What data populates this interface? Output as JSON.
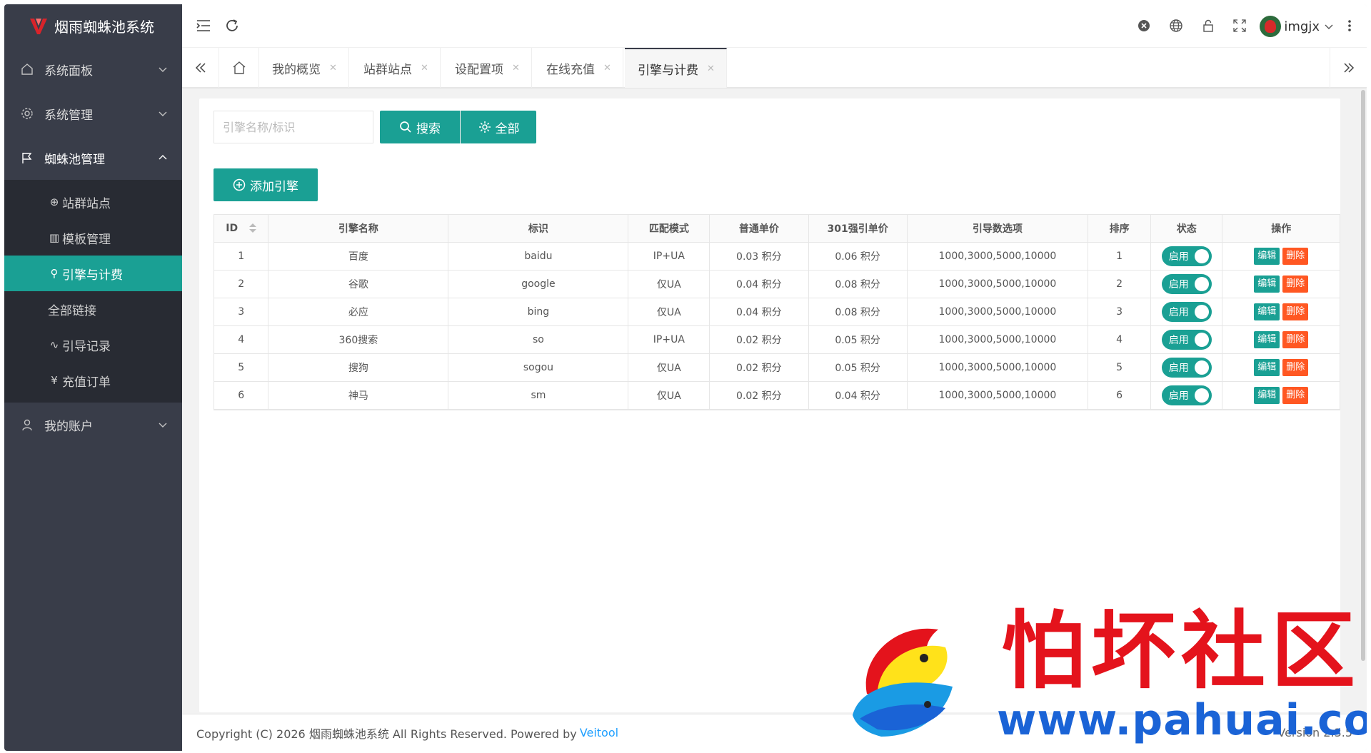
{
  "app": {
    "title": "烟雨蜘蛛池系统"
  },
  "sidebar": {
    "items": [
      {
        "label": "系统面板"
      },
      {
        "label": "系统管理"
      },
      {
        "label": "蜘蛛池管理"
      },
      {
        "label": "我的账户"
      }
    ],
    "sub_items": [
      {
        "label": "站群站点"
      },
      {
        "label": "模板管理"
      },
      {
        "label": "引擎与计费"
      },
      {
        "label": "全部链接"
      },
      {
        "label": "引导记录"
      },
      {
        "label": "充值订单"
      }
    ]
  },
  "header": {
    "username": "imgjx"
  },
  "tabs": [
    {
      "label": "我的概览"
    },
    {
      "label": "站群站点"
    },
    {
      "label": "设配置项"
    },
    {
      "label": "在线充值"
    },
    {
      "label": "引擎与计费"
    }
  ],
  "search": {
    "placeholder": "引擎名称/标识",
    "search_label": "搜索",
    "all_label": "全部"
  },
  "add_label": "添加引擎",
  "table": {
    "headers": [
      "ID",
      "引擎名称",
      "标识",
      "匹配模式",
      "普通单价",
      "301强引单价",
      "引导数选项",
      "排序",
      "状态",
      "操作"
    ],
    "status_label": "启用",
    "edit_label": "编辑",
    "delete_label": "删除",
    "rows": [
      [
        "1",
        "百度",
        "baidu",
        "IP+UA",
        "0.03 积分",
        "0.06 积分",
        "1000,3000,5000,10000",
        "1"
      ],
      [
        "2",
        "谷歌",
        "google",
        "仅UA",
        "0.04 积分",
        "0.08 积分",
        "1000,3000,5000,10000",
        "2"
      ],
      [
        "3",
        "必应",
        "bing",
        "仅UA",
        "0.04 积分",
        "0.08 积分",
        "1000,3000,5000,10000",
        "3"
      ],
      [
        "4",
        "360搜索",
        "so",
        "IP+UA",
        "0.02 积分",
        "0.05 积分",
        "1000,3000,5000,10000",
        "4"
      ],
      [
        "5",
        "搜狗",
        "sogou",
        "仅UA",
        "0.02 积分",
        "0.05 积分",
        "1000,3000,5000,10000",
        "5"
      ],
      [
        "6",
        "神马",
        "sm",
        "仅UA",
        "0.02 积分",
        "0.04 积分",
        "1000,3000,5000,10000",
        "6"
      ]
    ]
  },
  "footer": {
    "copyright": "Copyright (C) 2026 烟雨蜘蛛池系统 All Rights Reserved. Powered by",
    "link": "Veitool",
    "version": "Version 2.3.5"
  },
  "watermark": {
    "title": "怕坏社区",
    "url": "www.pahuai.com"
  },
  "colors": {
    "accent": "#1aa094",
    "sidebar": "#393d49",
    "danger": "#ff5722"
  }
}
